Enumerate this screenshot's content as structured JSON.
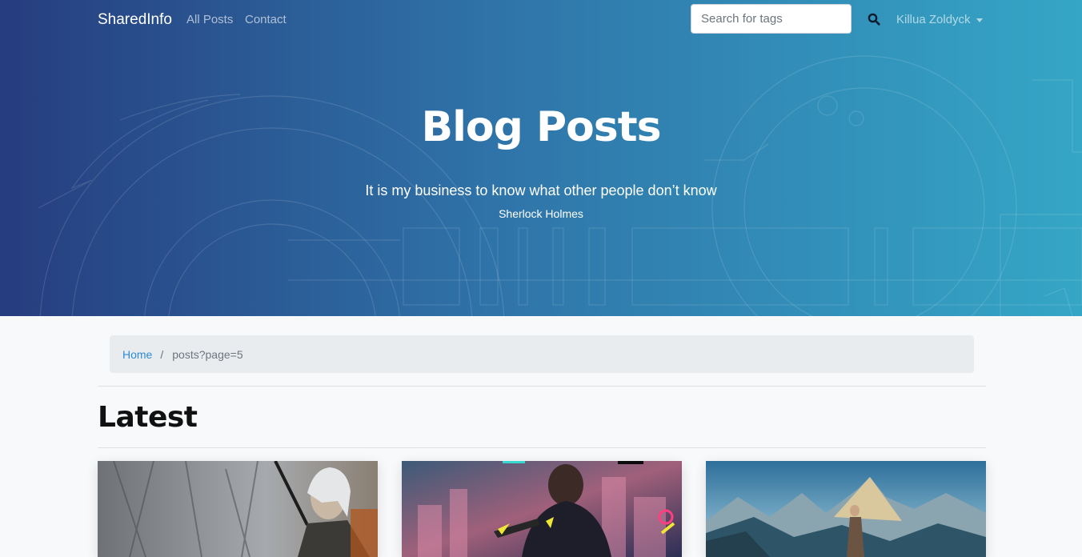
{
  "nav": {
    "brand": "SharedInfo",
    "links": [
      "All Posts",
      "Contact"
    ],
    "search_placeholder": "Search for tags",
    "search_icon": "search-icon",
    "user_name": "Killua Zoldyck",
    "user_caret_icon": "caret-down-icon"
  },
  "hero": {
    "title": "Blog Posts",
    "quote": "It is my business to know what other people don’t know",
    "author": "Sherlock Holmes"
  },
  "breadcrumb": {
    "home": "Home",
    "separator": "/",
    "current": "posts?page=5"
  },
  "latest": {
    "title": "Latest",
    "cards": [
      {
        "image": "witcher-artwork"
      },
      {
        "image": "cyberpunk-artwork"
      },
      {
        "image": "god-of-war-artwork"
      }
    ]
  },
  "colors": {
    "hero_gradient_start": "#263d7e",
    "hero_gradient_end": "#35a6c6",
    "link_blue": "#2f8ad6",
    "breadcrumb_bg": "#e9ecef",
    "page_bg": "#f8f9fa"
  }
}
